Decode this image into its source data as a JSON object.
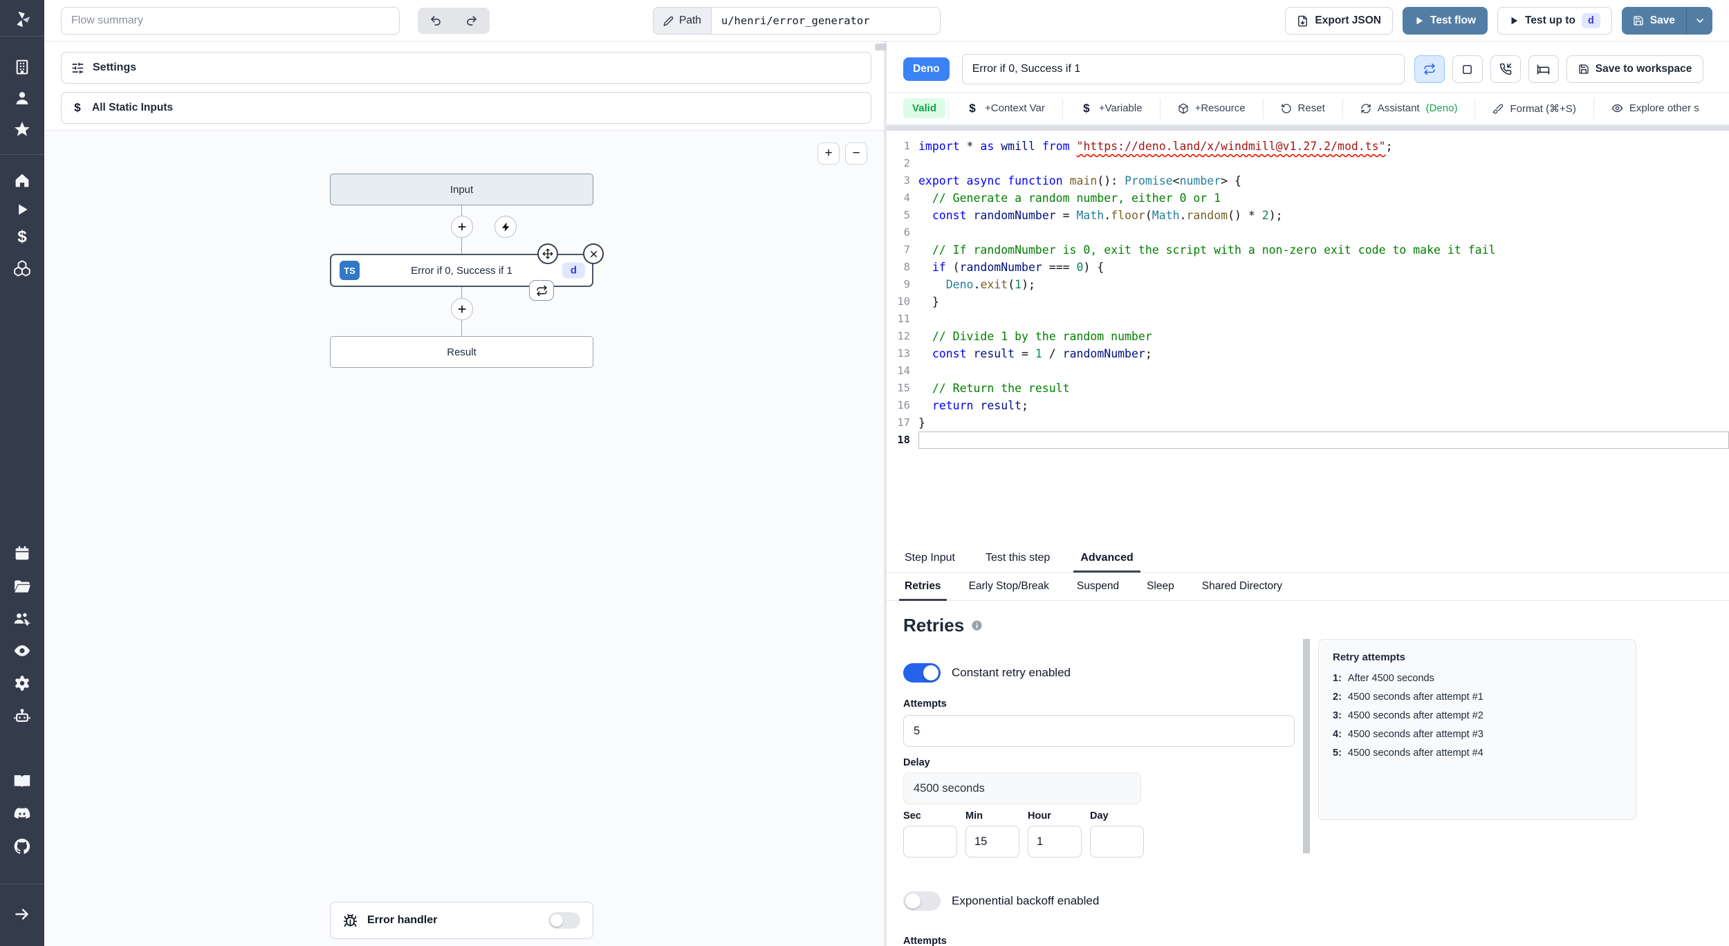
{
  "topbar": {
    "flow_summary_placeholder": "Flow summary",
    "path_label": "Path",
    "path_value": "u/henri/error_generator",
    "export_json_label": "Export JSON",
    "test_flow_label": "Test flow",
    "test_up_to_label": "Test up to",
    "test_up_to_badge": "d",
    "save_label": "Save"
  },
  "left_panel": {
    "settings_label": "Settings",
    "static_inputs_label": "All Static Inputs",
    "zoom_in": "+",
    "zoom_out": "−",
    "graph": {
      "input_node_label": "Input",
      "step_node": {
        "lang_badge": "TS",
        "label": "Error if 0, Success if 1",
        "suspend_badge": "d"
      },
      "result_node_label": "Result",
      "error_handler_label": "Error handler"
    }
  },
  "right_panel": {
    "lang_badge": "Deno",
    "step_title": "Error if 0, Success if 1",
    "save_to_workspace_label": "Save to workspace",
    "toolbar": {
      "valid_label": "Valid",
      "context_var_label": "+Context Var",
      "variable_label": "+Variable",
      "resource_label": "+Resource",
      "reset_label": "Reset",
      "assistant_label": "Assistant",
      "assistant_lang": "(Deno)",
      "format_label": "Format (⌘+S)",
      "explore_label": "Explore other s"
    },
    "tabs": [
      {
        "label": "Step Input",
        "active": false
      },
      {
        "label": "Test this step",
        "active": false
      },
      {
        "label": "Advanced",
        "active": true
      }
    ],
    "subtabs": [
      {
        "label": "Retries",
        "active": true
      },
      {
        "label": "Early Stop/Break",
        "active": false
      },
      {
        "label": "Suspend",
        "active": false
      },
      {
        "label": "Sleep",
        "active": false
      },
      {
        "label": "Shared Directory",
        "active": false
      }
    ],
    "editor": {
      "lines": [
        {
          "n": 1,
          "tokens": [
            [
              "import",
              "kw"
            ],
            [
              " * ",
              "pun"
            ],
            [
              "as",
              "kw"
            ],
            [
              " wmill ",
              "id"
            ],
            [
              "from",
              "kw"
            ],
            [
              " ",
              "pun"
            ],
            [
              "\"https://deno.land/x/windmill@v1.27.2/mod.ts\"",
              "str sq"
            ],
            [
              ";",
              "pun"
            ]
          ]
        },
        {
          "n": 2,
          "tokens": []
        },
        {
          "n": 3,
          "tokens": [
            [
              "export",
              "kw"
            ],
            [
              " ",
              "pun"
            ],
            [
              "async",
              "kw"
            ],
            [
              " ",
              "pun"
            ],
            [
              "function",
              "kw"
            ],
            [
              " ",
              "pun"
            ],
            [
              "main",
              "fn"
            ],
            [
              "(): ",
              "pun"
            ],
            [
              "Promise",
              "type"
            ],
            [
              "<",
              "pun"
            ],
            [
              "number",
              "type"
            ],
            [
              "> {",
              "pun"
            ]
          ]
        },
        {
          "n": 4,
          "tokens": [
            [
              "  // Generate a random number, either 0 or 1",
              "com"
            ]
          ]
        },
        {
          "n": 5,
          "tokens": [
            [
              "  ",
              "pun"
            ],
            [
              "const",
              "kw"
            ],
            [
              " randomNumber ",
              "id"
            ],
            [
              "= ",
              "pun"
            ],
            [
              "Math",
              "type"
            ],
            [
              ".",
              "pun"
            ],
            [
              "floor",
              "fn"
            ],
            [
              "(",
              "pun"
            ],
            [
              "Math",
              "type"
            ],
            [
              ".",
              "pun"
            ],
            [
              "random",
              "fn"
            ],
            [
              "() ",
              "pun"
            ],
            [
              "* ",
              "pun"
            ],
            [
              "2",
              "num"
            ],
            [
              ");",
              "pun"
            ]
          ]
        },
        {
          "n": 6,
          "tokens": []
        },
        {
          "n": 7,
          "tokens": [
            [
              "  // If randomNumber is 0, exit the script with a non-zero exit code to make it fail",
              "com"
            ]
          ]
        },
        {
          "n": 8,
          "tokens": [
            [
              "  ",
              "pun"
            ],
            [
              "if",
              "kw"
            ],
            [
              " (",
              "pun"
            ],
            [
              "randomNumber",
              "id"
            ],
            [
              " === ",
              "pun"
            ],
            [
              "0",
              "num"
            ],
            [
              ") {",
              "pun"
            ]
          ]
        },
        {
          "n": 9,
          "tokens": [
            [
              "    ",
              "pun"
            ],
            [
              "Deno",
              "type"
            ],
            [
              ".",
              "pun"
            ],
            [
              "exit",
              "fn"
            ],
            [
              "(",
              "pun"
            ],
            [
              "1",
              "num"
            ],
            [
              ");",
              "pun"
            ]
          ]
        },
        {
          "n": 10,
          "tokens": [
            [
              "  }",
              "pun"
            ]
          ]
        },
        {
          "n": 11,
          "tokens": []
        },
        {
          "n": 12,
          "tokens": [
            [
              "  // Divide 1 by the random number",
              "com"
            ]
          ]
        },
        {
          "n": 13,
          "tokens": [
            [
              "  ",
              "pun"
            ],
            [
              "const",
              "kw"
            ],
            [
              " result ",
              "id"
            ],
            [
              "= ",
              "pun"
            ],
            [
              "1",
              "num"
            ],
            [
              " / ",
              "pun"
            ],
            [
              "randomNumber",
              "id"
            ],
            [
              ";",
              "pun"
            ]
          ]
        },
        {
          "n": 14,
          "tokens": []
        },
        {
          "n": 15,
          "tokens": [
            [
              "  // Return the result",
              "com"
            ]
          ]
        },
        {
          "n": 16,
          "tokens": [
            [
              "  ",
              "pun"
            ],
            [
              "return",
              "kw"
            ],
            [
              " result",
              "id"
            ],
            [
              ";",
              "pun"
            ]
          ]
        },
        {
          "n": 17,
          "tokens": [
            [
              "}",
              "pun"
            ]
          ]
        },
        {
          "n": 18,
          "tokens": [],
          "active": true
        }
      ]
    },
    "retries": {
      "heading": "Retries",
      "constant_toggle_label": "Constant retry enabled",
      "constant_toggle_on": true,
      "attempts_label": "Attempts",
      "attempts_value": "5",
      "delay_label": "Delay",
      "delay_value": "4500 seconds",
      "time_fields": [
        {
          "label": "Sec",
          "value": ""
        },
        {
          "label": "Min",
          "value": "15"
        },
        {
          "label": "Hour",
          "value": "1"
        },
        {
          "label": "Day",
          "value": ""
        }
      ],
      "exponential_toggle_label": "Exponential backoff enabled",
      "exponential_toggle_on": false,
      "clipped_label": "Attempts",
      "retry_attempts": {
        "title": "Retry attempts",
        "items": [
          {
            "n": "1:",
            "text": "After 4500 seconds"
          },
          {
            "n": "2:",
            "text": "4500 seconds after attempt #1"
          },
          {
            "n": "3:",
            "text": "4500 seconds after attempt #2"
          },
          {
            "n": "4:",
            "text": "4500 seconds after attempt #3"
          },
          {
            "n": "5:",
            "text": "4500 seconds after attempt #4"
          }
        ]
      }
    }
  },
  "colors": {
    "sidebar_bg": "#343b4a",
    "primary_button_blue": "#527ea6",
    "deno_badge_blue": "#3b82f6",
    "ts_badge_blue": "#3178c6",
    "toggle_on_blue": "#2563eb",
    "valid_badge_bg": "#dcfce7",
    "valid_badge_text": "#16a34a",
    "indigo_chip_bg": "#e0e7ff",
    "indigo_chip_text": "#4338ca"
  }
}
